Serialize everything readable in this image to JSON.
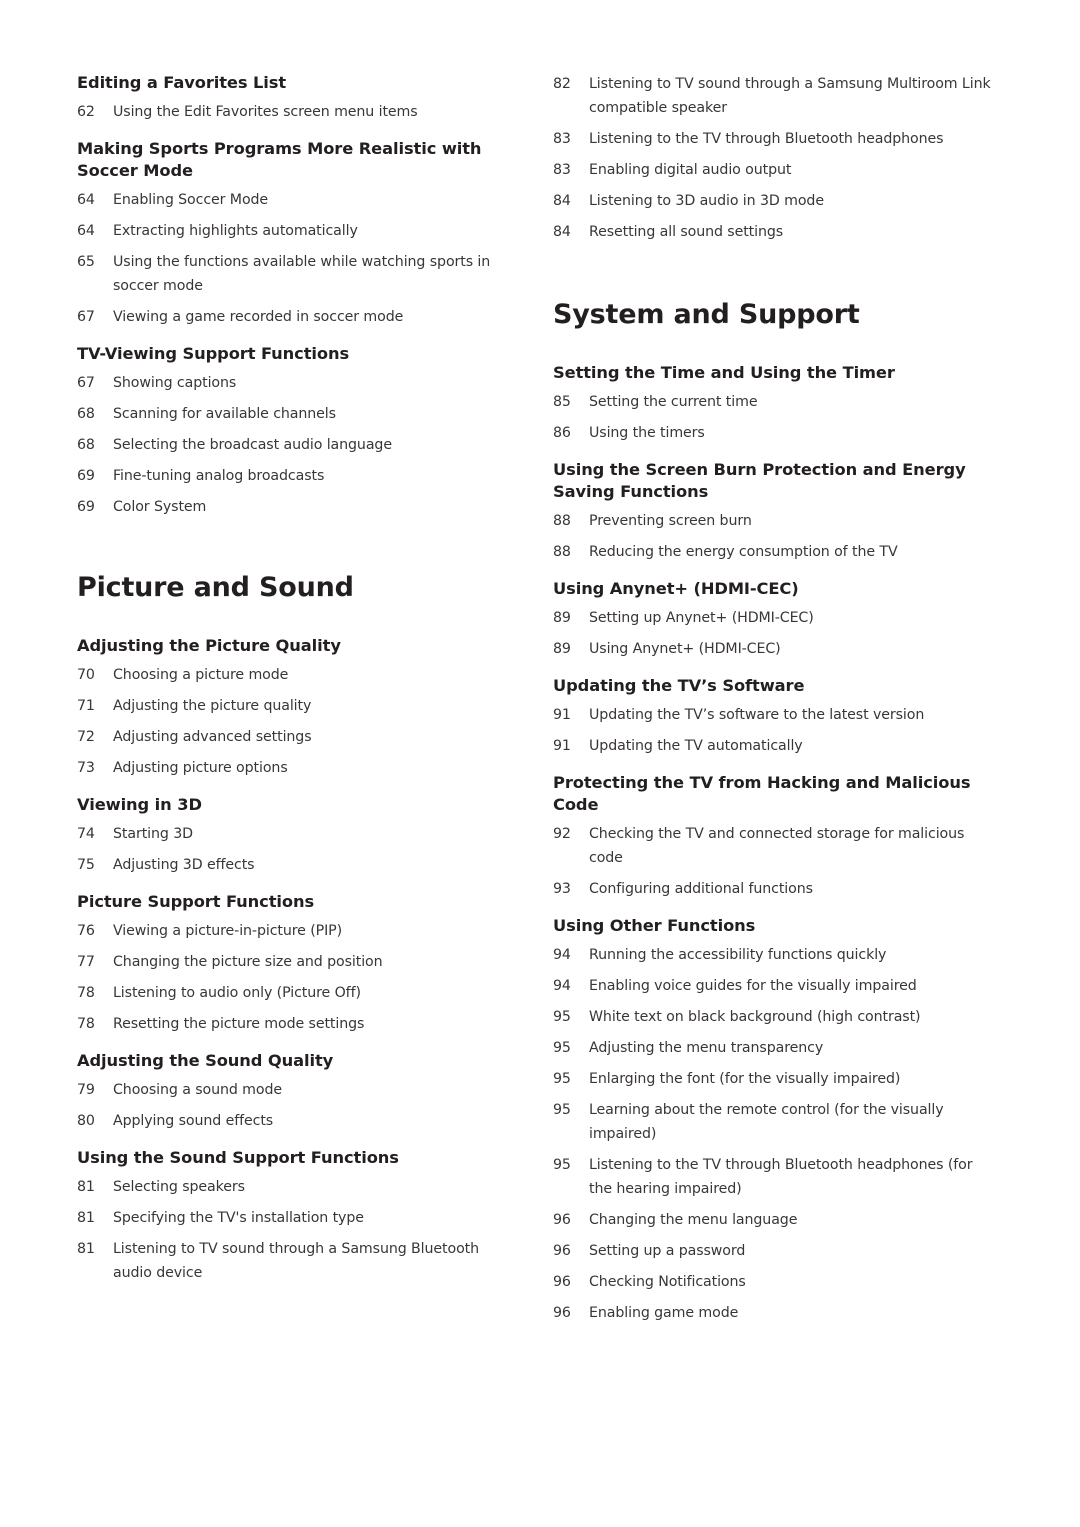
{
  "left_column": {
    "pre_sections": [
      {
        "heading": "Editing a Favorites List",
        "items": [
          {
            "page": "62",
            "text": "Using the Edit Favorites screen menu items"
          }
        ]
      },
      {
        "heading": "Making Sports Programs More Realistic with Soccer Mode",
        "items": [
          {
            "page": "64",
            "text": "Enabling Soccer Mode"
          },
          {
            "page": "64",
            "text": "Extracting highlights automatically"
          },
          {
            "page": "65",
            "text": "Using the functions available while watching sports in soccer mode"
          },
          {
            "page": "67",
            "text": "Viewing a game recorded in soccer mode"
          }
        ]
      },
      {
        "heading": "TV-Viewing Support Functions",
        "items": [
          {
            "page": "67",
            "text": "Showing captions"
          },
          {
            "page": "68",
            "text": "Scanning for available channels"
          },
          {
            "page": "68",
            "text": "Selecting the broadcast audio language"
          },
          {
            "page": "69",
            "text": "Fine-tuning analog broadcasts"
          },
          {
            "page": "69",
            "text": "Color System"
          }
        ]
      }
    ],
    "chapter": {
      "title": "Picture and Sound",
      "sections": [
        {
          "heading": "Adjusting the Picture Quality",
          "items": [
            {
              "page": "70",
              "text": "Choosing a picture mode"
            },
            {
              "page": "71",
              "text": "Adjusting the picture quality"
            },
            {
              "page": "72",
              "text": "Adjusting advanced settings"
            },
            {
              "page": "73",
              "text": "Adjusting picture options"
            }
          ]
        },
        {
          "heading": "Viewing in 3D",
          "items": [
            {
              "page": "74",
              "text": "Starting 3D"
            },
            {
              "page": "75",
              "text": "Adjusting 3D effects"
            }
          ]
        },
        {
          "heading": "Picture Support Functions",
          "items": [
            {
              "page": "76",
              "text": "Viewing a picture-in-picture (PIP)"
            },
            {
              "page": "77",
              "text": "Changing the picture size and position"
            },
            {
              "page": "78",
              "text": "Listening to audio only (Picture Off)"
            },
            {
              "page": "78",
              "text": "Resetting the picture mode settings"
            }
          ]
        },
        {
          "heading": "Adjusting the Sound Quality",
          "items": [
            {
              "page": "79",
              "text": "Choosing a sound mode"
            },
            {
              "page": "80",
              "text": "Applying sound effects"
            }
          ]
        },
        {
          "heading": "Using the Sound Support Functions",
          "items": [
            {
              "page": "81",
              "text": "Selecting speakers"
            },
            {
              "page": "81",
              "text": "Specifying the TV's installation type"
            },
            {
              "page": "81",
              "text": "Listening to TV sound through a Samsung Bluetooth audio device"
            }
          ]
        }
      ]
    }
  },
  "right_column": {
    "continued_items": [
      {
        "page": "82",
        "text": "Listening to TV sound through a Samsung Multiroom Link compatible speaker"
      },
      {
        "page": "83",
        "text": "Listening to the TV through Bluetooth headphones"
      },
      {
        "page": "83",
        "text": "Enabling digital audio output"
      },
      {
        "page": "84",
        "text": "Listening to 3D audio in 3D mode"
      },
      {
        "page": "84",
        "text": "Resetting all sound settings"
      }
    ],
    "chapter": {
      "title": "System and Support",
      "sections": [
        {
          "heading": "Setting the Time and Using the Timer",
          "items": [
            {
              "page": "85",
              "text": "Setting the current time"
            },
            {
              "page": "86",
              "text": "Using the timers"
            }
          ]
        },
        {
          "heading": "Using the Screen Burn Protection and Energy Saving Functions",
          "items": [
            {
              "page": "88",
              "text": "Preventing screen burn"
            },
            {
              "page": "88",
              "text": "Reducing the energy consumption of the TV"
            }
          ]
        },
        {
          "heading": "Using Anynet+ (HDMI-CEC)",
          "items": [
            {
              "page": "89",
              "text": "Setting up Anynet+ (HDMI-CEC)"
            },
            {
              "page": "89",
              "text": "Using Anynet+ (HDMI-CEC)"
            }
          ]
        },
        {
          "heading": "Updating the TV’s Software",
          "items": [
            {
              "page": "91",
              "text": "Updating the TV’s software to the latest version"
            },
            {
              "page": "91",
              "text": "Updating the TV automatically"
            }
          ]
        },
        {
          "heading": "Protecting the TV from Hacking and Malicious Code",
          "items": [
            {
              "page": "92",
              "text": "Checking the TV and connected storage for malicious code"
            },
            {
              "page": "93",
              "text": "Configuring additional functions"
            }
          ]
        },
        {
          "heading": "Using Other Functions",
          "items": [
            {
              "page": "94",
              "text": "Running the accessibility functions quickly"
            },
            {
              "page": "94",
              "text": "Enabling voice guides for the visually impaired"
            },
            {
              "page": "95",
              "text": "White text on black background (high contrast)"
            },
            {
              "page": "95",
              "text": "Adjusting the menu transparency"
            },
            {
              "page": "95",
              "text": "Enlarging the font (for the visually impaired)"
            },
            {
              "page": "95",
              "text": "Learning about the remote control (for the visually impaired)"
            },
            {
              "page": "95",
              "text": "Listening to the TV through Bluetooth headphones (for the hearing impaired)"
            },
            {
              "page": "96",
              "text": "Changing the menu language"
            },
            {
              "page": "96",
              "text": "Setting up a password"
            },
            {
              "page": "96",
              "text": "Checking Notifications"
            },
            {
              "page": "96",
              "text": "Enabling game mode"
            }
          ]
        }
      ]
    }
  }
}
